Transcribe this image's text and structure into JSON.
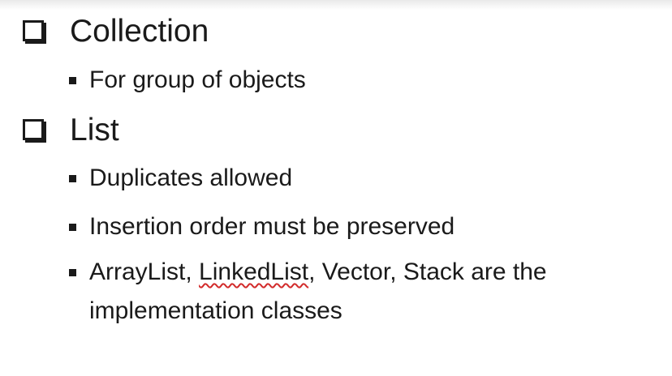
{
  "outline": [
    {
      "heading": "Collection",
      "items": [
        {
          "text": "For group of objects"
        }
      ]
    },
    {
      "heading": "List",
      "items": [
        {
          "text": "Duplicates allowed"
        },
        {
          "text": "Insertion order must be preserved"
        },
        {
          "before": "ArrayList, ",
          "spellcheck_word": "LinkedList",
          "after": ", Vector, Stack are the",
          "line2": "implementation classes"
        }
      ]
    }
  ],
  "spellcheck_underline_color": "#d22b2b"
}
